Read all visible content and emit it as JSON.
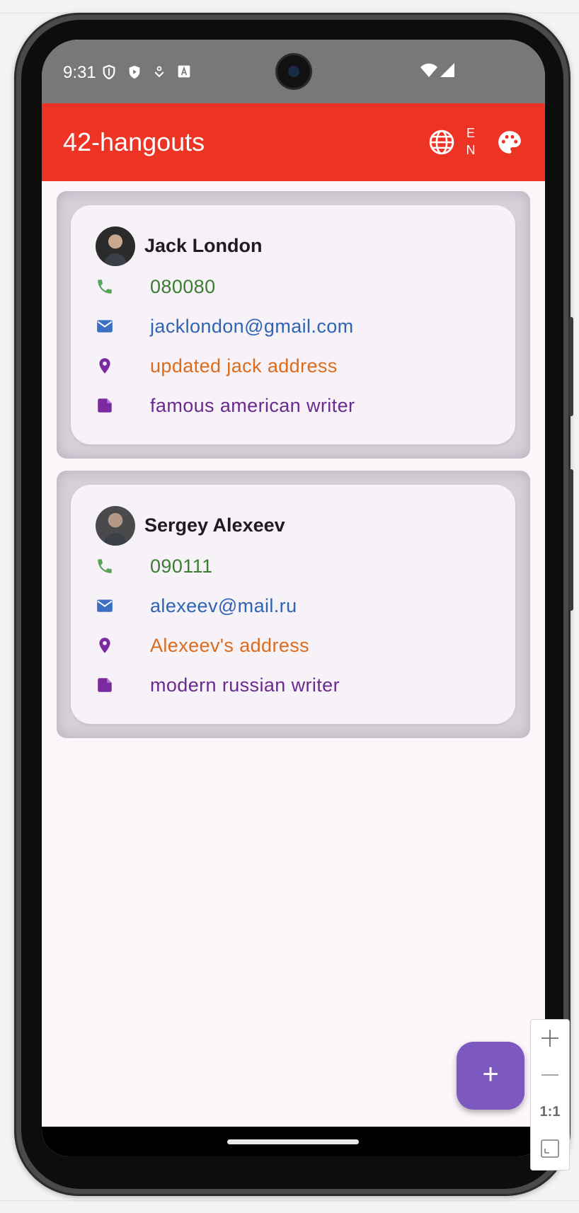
{
  "status_bar": {
    "time": "9:31",
    "icons": [
      "shield-outline-icon",
      "play-protect-icon",
      "download-icon",
      "a-box-icon",
      "wifi-icon",
      "signal-icon"
    ]
  },
  "app_bar": {
    "title": "42-hangouts",
    "language_code_line1": "E",
    "language_code_line2": "N",
    "color": "#ec3324"
  },
  "contacts": [
    {
      "name": "Jack London",
      "phone": "080080",
      "email": "jacklondon@gmail.com",
      "address": "updated jack address",
      "note": "famous american writer"
    },
    {
      "name": "Sergey Alexeev",
      "phone": "090111",
      "email": "alexeev@mail.ru",
      "address": "Alexeev's address",
      "note": "modern russian writer"
    }
  ],
  "fab": {
    "label": "+",
    "color": "#7c58bf"
  },
  "zoom_panel": {
    "zoom_in": "+",
    "zoom_out": "—",
    "reset_label": "1:1"
  },
  "colors": {
    "phone_text": "#3c7d33",
    "email_text": "#2f64b4",
    "address_text": "#db6c1c",
    "note_text": "#6a2a8e"
  }
}
